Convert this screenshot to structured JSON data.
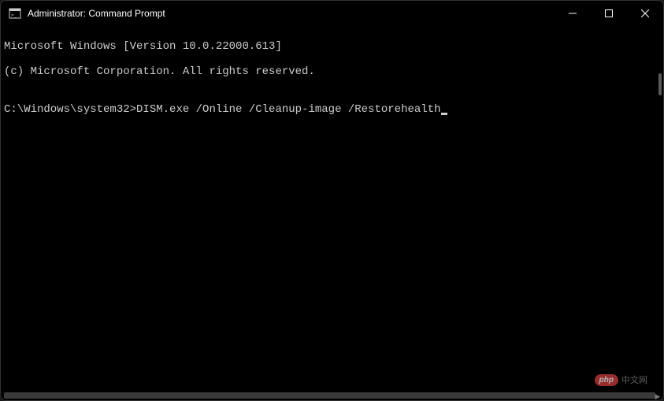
{
  "titlebar": {
    "title": "Administrator: Command Prompt"
  },
  "terminal": {
    "line1": "Microsoft Windows [Version 10.0.22000.613]",
    "line2": "(c) Microsoft Corporation. All rights reserved.",
    "blank": "",
    "prompt": "C:\\Windows\\system32>",
    "command": "DISM.exe /Online /Cleanup-image /Restorehealth"
  },
  "watermark": {
    "badge": "php",
    "text": "中文网"
  }
}
